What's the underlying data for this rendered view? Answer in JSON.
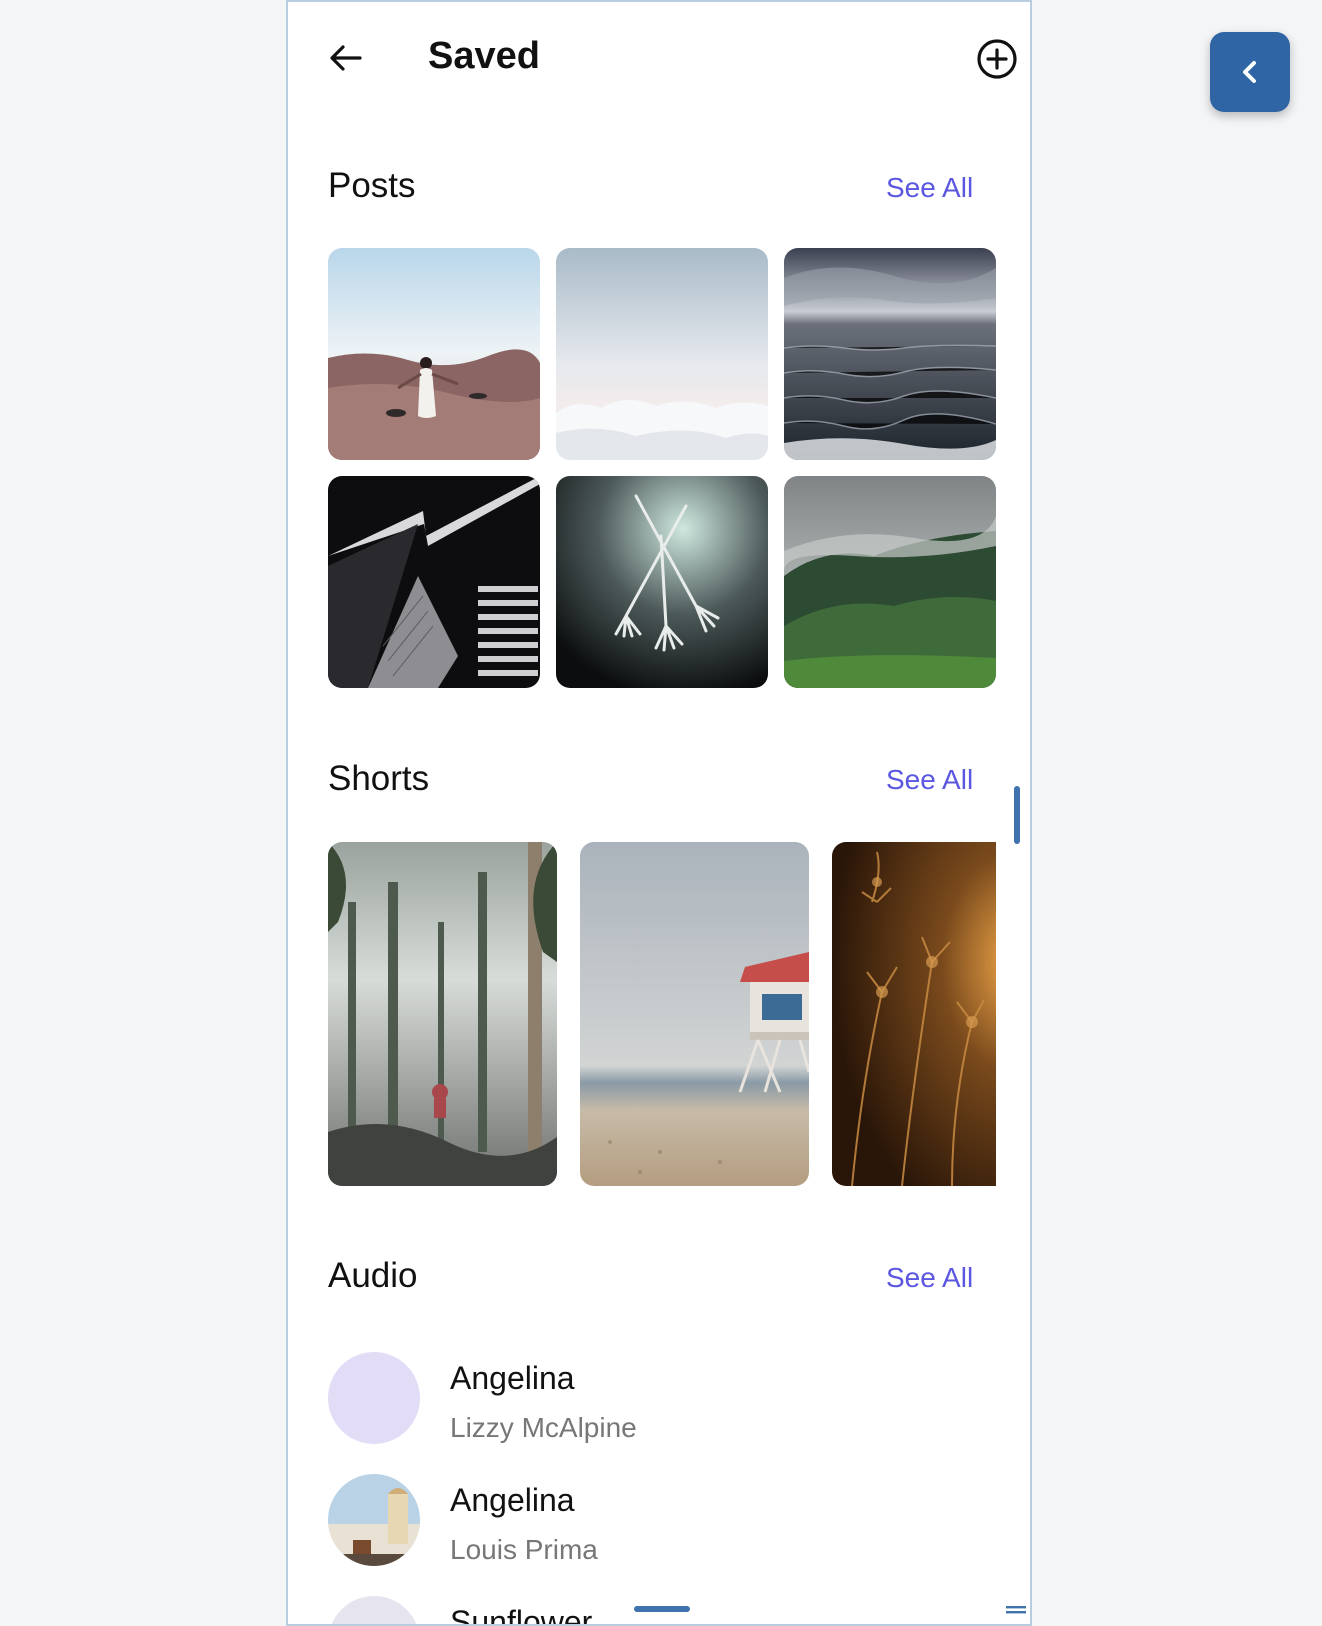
{
  "header": {
    "title": "Saved"
  },
  "sections": {
    "posts": {
      "title": "Posts",
      "see_all": "See All"
    },
    "shorts": {
      "title": "Shorts",
      "see_all": "See All"
    },
    "audio": {
      "title": "Audio",
      "see_all": "See All"
    }
  },
  "posts": [
    {
      "label": "woman-on-beach"
    },
    {
      "label": "clouds-sky"
    },
    {
      "label": "ocean-waves"
    },
    {
      "label": "building-architecture"
    },
    {
      "label": "forks"
    },
    {
      "label": "misty-forest-hill"
    }
  ],
  "shorts": [
    {
      "label": "foggy-forest"
    },
    {
      "label": "lifeguard-tower-beach"
    },
    {
      "label": "golden-plants"
    }
  ],
  "audio": [
    {
      "title": "Angelina",
      "artist": "Lizzy McAlpine"
    },
    {
      "title": "Angelina",
      "artist": "Louis Prima"
    },
    {
      "title": "Sunflower",
      "artist": ""
    }
  ],
  "colors": {
    "accent": "#5b57e0",
    "brand": "#2f65a5",
    "scrollbar": "#3f73ad"
  },
  "icons": {
    "back": "arrow-left-icon",
    "add": "plus-circle-icon",
    "collapse": "chevron-left-icon"
  }
}
